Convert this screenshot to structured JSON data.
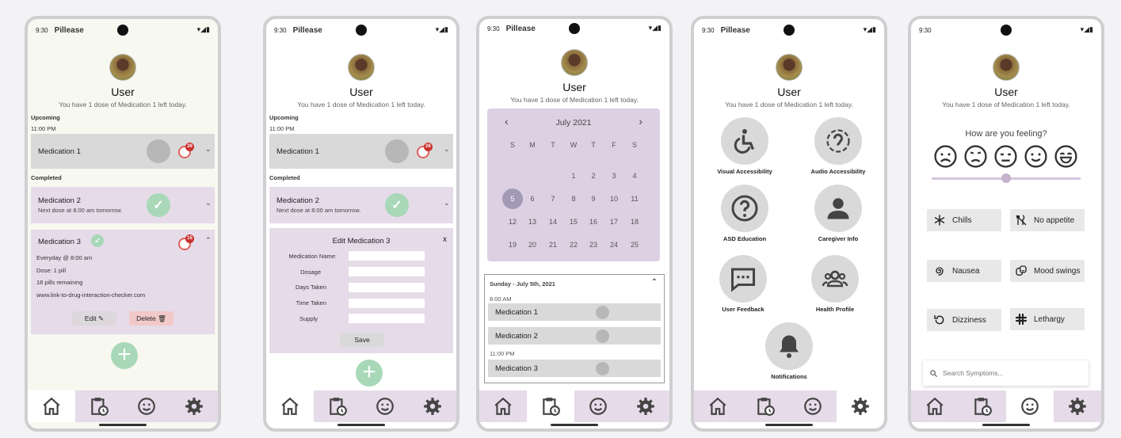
{
  "app_name": "Pillease",
  "status": {
    "time": "9:30",
    "signal": "▾◢▮"
  },
  "user": {
    "name": "User",
    "message": "You have 1 dose of Medication 1 left today."
  },
  "home": {
    "upcoming_label": "Upcoming",
    "upcoming_time": "11:00 PM",
    "completed_label": "Completed",
    "med1": {
      "name": "Medication 1",
      "streak": "26"
    },
    "med2": {
      "name": "Medication 2",
      "note": "Next dose at 8:00 am tomorrow."
    },
    "med3": {
      "name": "Medication 3",
      "streak": "15",
      "schedule": "Everyday @ 8:00 am",
      "dose": "Dose: 1 pill",
      "remaining": "18 pills remaining",
      "link": "www.link-to-drug-interaction-checker.com",
      "edit_label": "Edit",
      "delete_label": "Delete"
    }
  },
  "edit": {
    "title": "Edit Medication 3",
    "close": "x",
    "fields": [
      "Medication Name:",
      "Dosage",
      "Days Taken",
      "Time Taken",
      "Supply"
    ],
    "save_label": "Save"
  },
  "calendar": {
    "month": "July 2021",
    "prev": "‹",
    "next": "›",
    "weekdays": [
      "S",
      "M",
      "T",
      "W",
      "T",
      "F",
      "S"
    ],
    "days": [
      "1",
      "2",
      "3",
      "4",
      "5",
      "6",
      "7",
      "8",
      "9",
      "10",
      "11",
      "12",
      "13",
      "14",
      "15",
      "16",
      "17",
      "18",
      "19",
      "20",
      "21",
      "22",
      "23",
      "24",
      "25"
    ],
    "selected_day": "5",
    "schedule_date": "Sunday - July 5th, 2021",
    "slot1_time": "8:00 AM",
    "slot2_time": "11:00 PM",
    "meds": [
      "Medication 1",
      "Medication 2",
      "Medication 3"
    ]
  },
  "settings": {
    "items": [
      "Visual Accessibility",
      "Audio Accessibility",
      "ASD Education",
      "Caregiver Info",
      "User Feedback",
      "Health Profile",
      "Notifications"
    ]
  },
  "symptoms": {
    "question": "How are you feeling?",
    "slider_value": 0.5,
    "items": [
      "Chills",
      "No appetite",
      "Nausea",
      "Mood swings",
      "Dizziness",
      "Lethargy"
    ],
    "search_placeholder": "Search Symptoms..."
  },
  "colors": {
    "accent_purple": "#e6dbe9",
    "calendar_purple": "#ddd0e3",
    "green": "#a8d8b8",
    "streak_red": "#c9302c"
  }
}
